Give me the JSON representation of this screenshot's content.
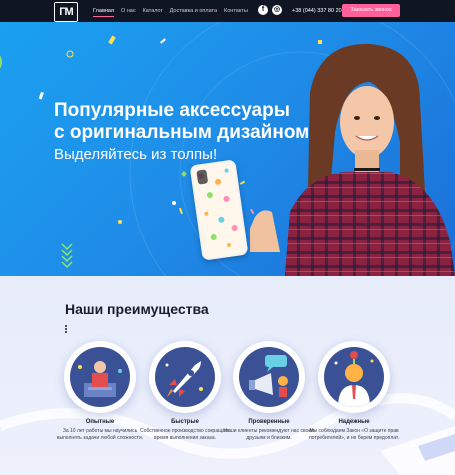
{
  "header": {
    "logo_text": "ГМ",
    "nav": [
      "Главная",
      "О нас",
      "Каталог",
      "Доставка и оплата",
      "Контакты"
    ],
    "social": [
      {
        "icon": "facebook-icon",
        "glyph": "f"
      },
      {
        "icon": "instagram-icon",
        "glyph": "◎"
      }
    ],
    "phone": "+38 (044) 337 80 20",
    "order_button": "Заказать звонок"
  },
  "hero": {
    "title_line1": "Популярные аксессуары",
    "title_line2": "с оригинальным дизайном",
    "subtitle": "Выделяйтесь из толпы!"
  },
  "advantages": {
    "title": "Наши преимущества",
    "items": [
      {
        "title": "Опытные",
        "text": "За 10 лет работы мы научились выполнять задачи любой сложности.",
        "icon": "experienced-worker-icon"
      },
      {
        "title": "Быстрые",
        "text": "Собственное производство сокращает время выполнения заказа.",
        "icon": "rocket-icon"
      },
      {
        "title": "Проверенные",
        "text": "Наши клиенты рекомендуют нас своим друзьям и близким.",
        "icon": "megaphone-icon"
      },
      {
        "title": "Надежные",
        "text": "Мы соблюдаем Закон «О защите прав потребителей», и не берем предоплат.",
        "icon": "reliable-person-icon"
      }
    ]
  },
  "colors": {
    "topbar": "#101524",
    "accent": "#ff5f9a",
    "hero_blue": "#1f8ee8",
    "icon_bg": "#3a5196"
  }
}
